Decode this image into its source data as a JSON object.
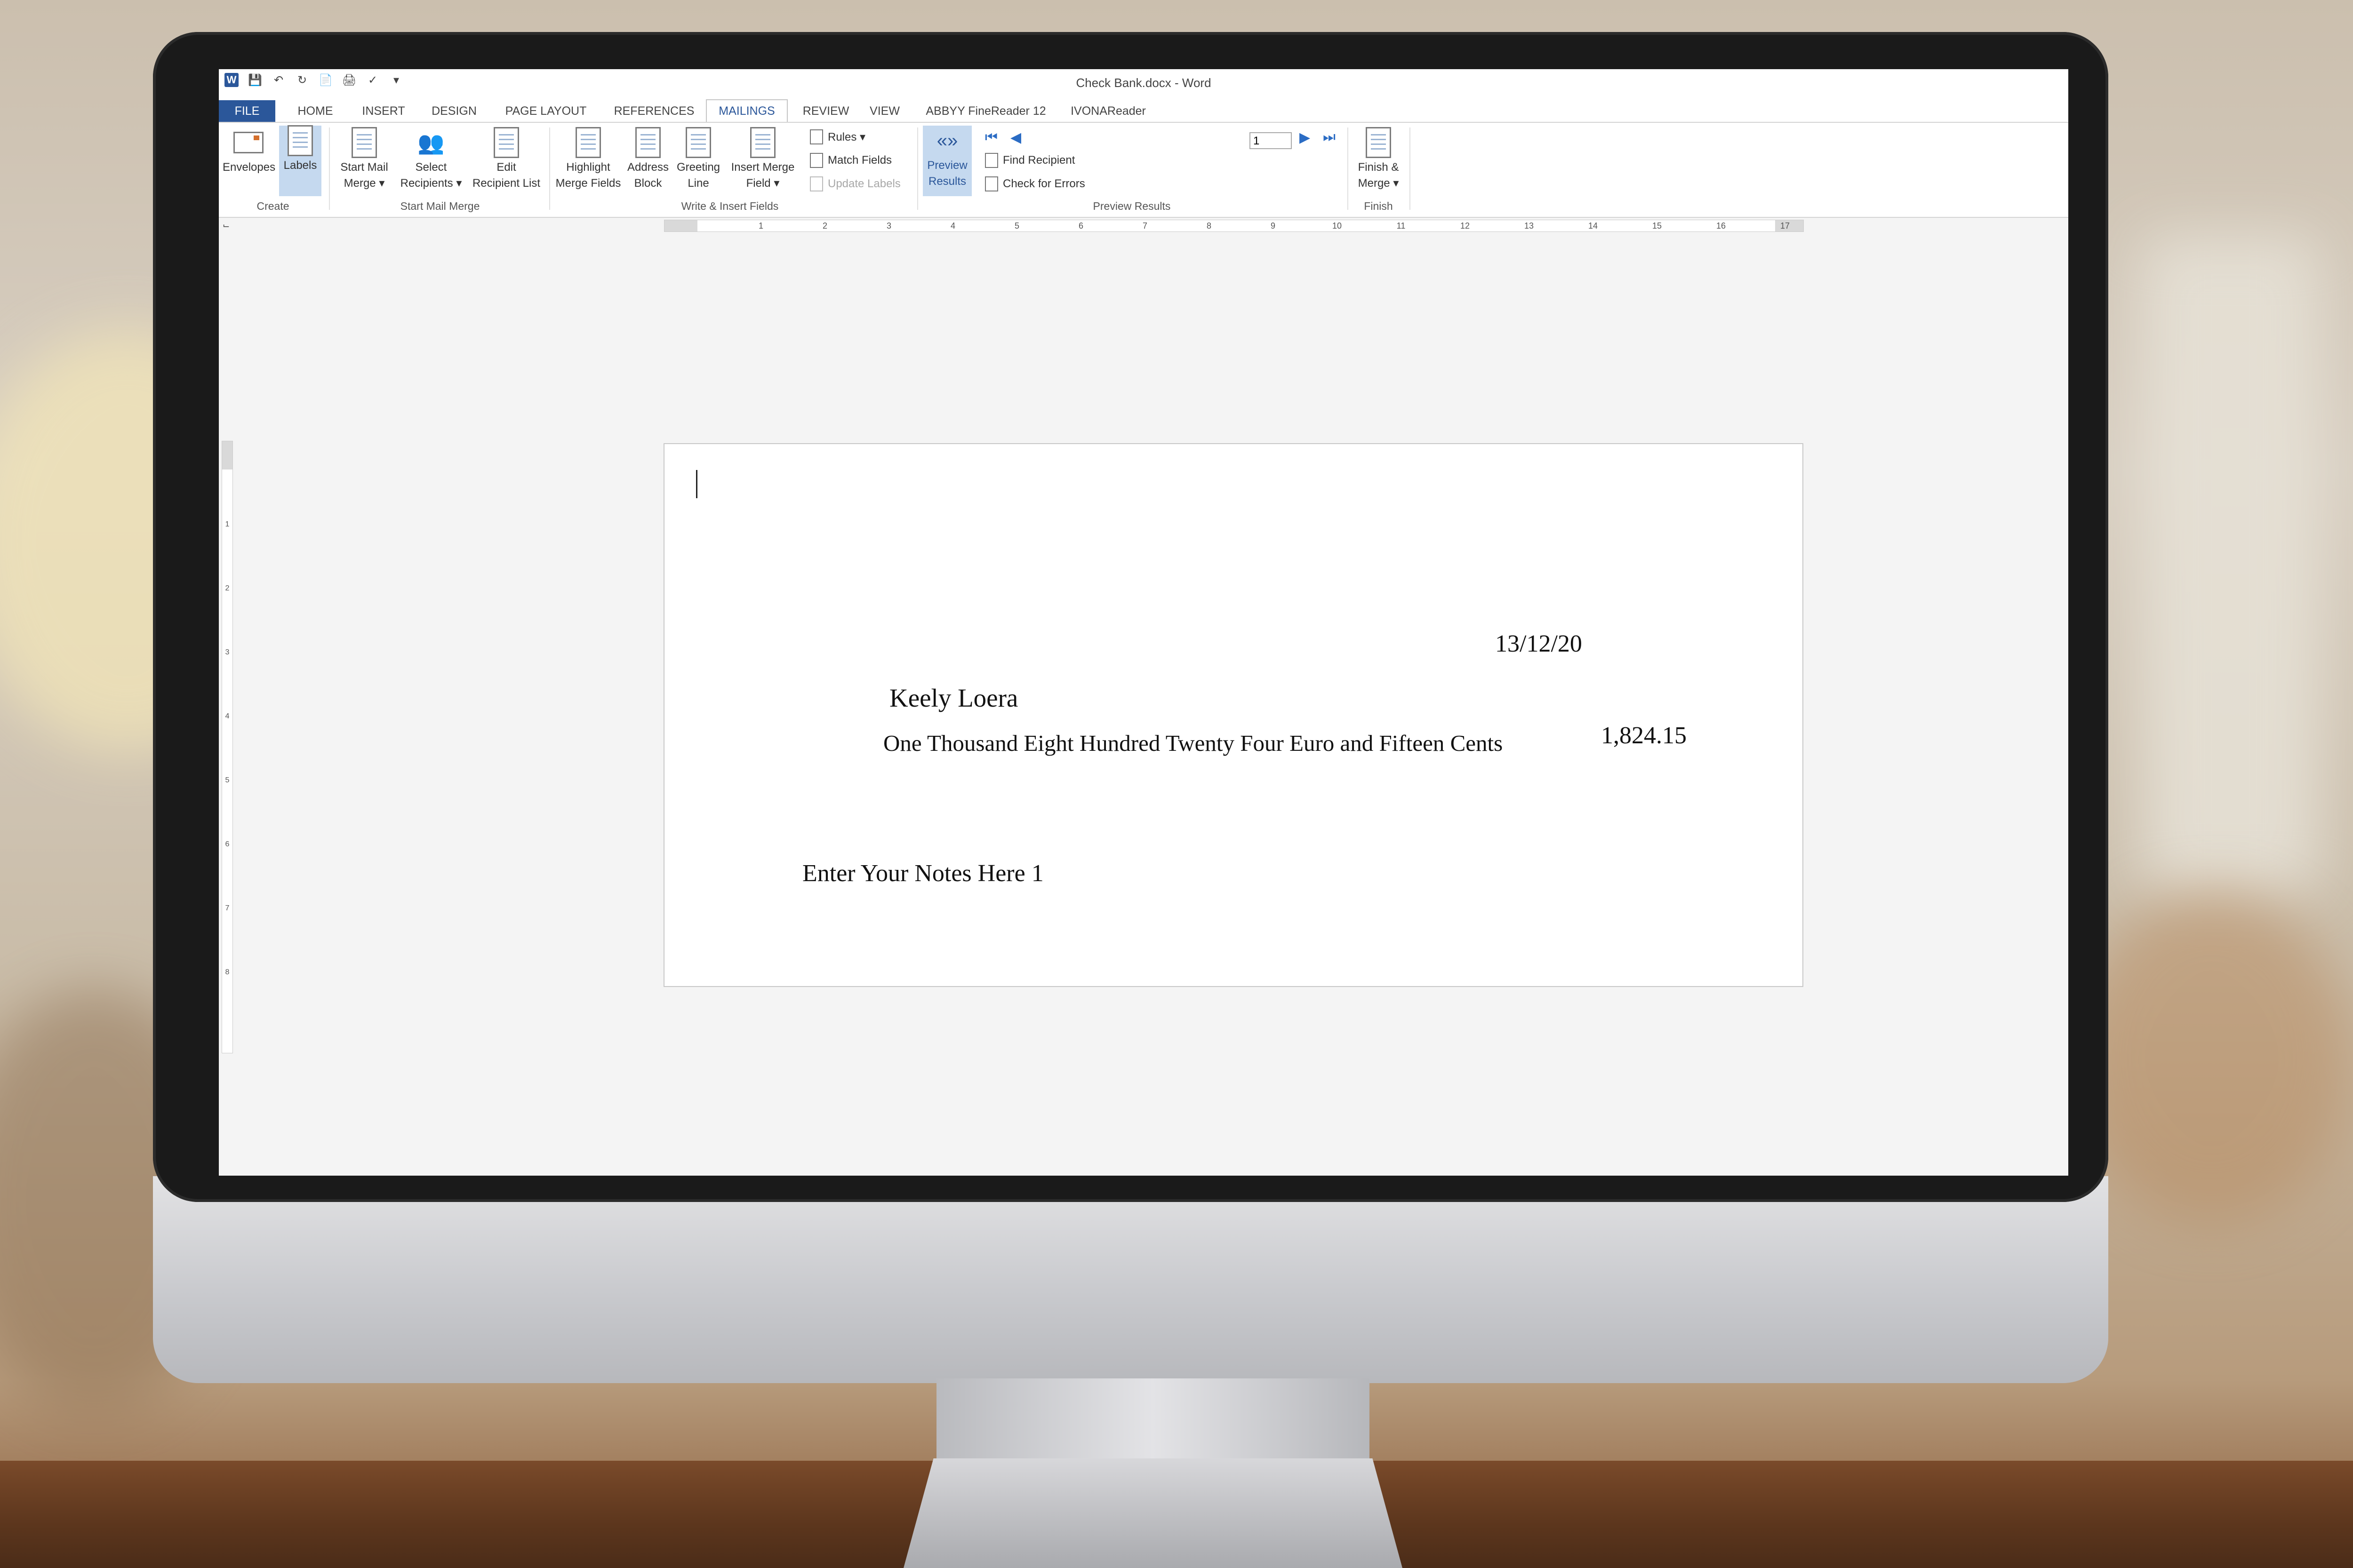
{
  "window": {
    "title": "Check Bank.docx - Word"
  },
  "quick_access": [
    "word-logo",
    "save-icon",
    "undo-icon",
    "redo-icon",
    "new-doc-icon",
    "print-icon",
    "spelling-icon",
    "customize-icon"
  ],
  "tabs": [
    {
      "label": "FILE"
    },
    {
      "label": "HOME"
    },
    {
      "label": "INSERT"
    },
    {
      "label": "DESIGN"
    },
    {
      "label": "PAGE LAYOUT"
    },
    {
      "label": "REFERENCES"
    },
    {
      "label": "MAILINGS"
    },
    {
      "label": "REVIEW"
    },
    {
      "label": "VIEW"
    },
    {
      "label": "ABBYY FineReader 12"
    },
    {
      "label": "IVONAReader"
    }
  ],
  "active_tab": "MAILINGS",
  "ribbon": {
    "create": {
      "label": "Create",
      "envelopes": "Envelopes",
      "labels": "Labels"
    },
    "start_mail_merge": {
      "label": "Start Mail Merge",
      "start_line1": "Start Mail",
      "start_line2": "Merge ▾",
      "select_line1": "Select",
      "select_line2": "Recipients ▾",
      "edit_line1": "Edit",
      "edit_line2": "Recipient List"
    },
    "write_insert": {
      "label": "Write & Insert Fields",
      "highlight_line1": "Highlight",
      "highlight_line2": "Merge Fields",
      "address_line1": "Address",
      "address_line2": "Block",
      "greeting_line1": "Greeting",
      "greeting_line2": "Line",
      "insert_line1": "Insert Merge",
      "insert_line2": "Field ▾",
      "rules": "Rules ▾",
      "match_fields": "Match Fields",
      "update_labels": "Update Labels"
    },
    "preview_results": {
      "label": "Preview Results",
      "preview_line1": "Preview",
      "preview_line2": "Results",
      "record_value": "1",
      "find_recipient": "Find Recipient",
      "check_errors": "Check for Errors"
    },
    "finish": {
      "label": "Finish",
      "finish_line1": "Finish &",
      "finish_line2": "Merge ▾"
    }
  },
  "ruler": {
    "horizontal": [
      "1",
      "2",
      "3",
      "4",
      "5",
      "6",
      "7",
      "8",
      "9",
      "10",
      "11",
      "12",
      "13",
      "14",
      "15",
      "16",
      "17"
    ],
    "vertical": [
      "1",
      "2",
      "3",
      "4",
      "5",
      "6",
      "7",
      "8"
    ]
  },
  "document": {
    "date": "13/12/20",
    "payee": "Keely Loera",
    "amount_words": "One Thousand Eight Hundred Twenty Four Euro and Fifteen Cents",
    "amount": "1,824.15",
    "notes": "Enter Your Notes Here 1"
  },
  "colors": {
    "accent": "#2b579a",
    "selected": "#c5d9ef"
  }
}
